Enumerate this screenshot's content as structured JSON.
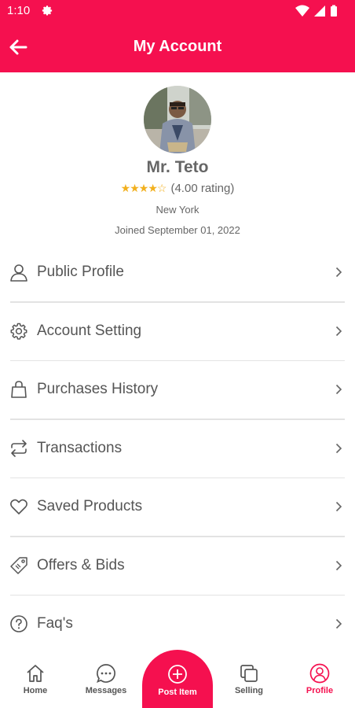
{
  "status_bar": {
    "time": "1:10"
  },
  "header": {
    "title": "My Account"
  },
  "profile": {
    "name": "Mr. Teto",
    "rating": 4,
    "rating_max": 5,
    "rating_text": "(4.00 rating)",
    "location": "New York",
    "joined": "Joined September 01, 2022"
  },
  "menu": [
    {
      "label": "Public Profile",
      "icon": "user-icon"
    },
    {
      "label": "Account Setting",
      "icon": "gear-icon"
    },
    {
      "label": "Purchases History",
      "icon": "shopping-bag-icon"
    },
    {
      "label": "Transactions",
      "icon": "swap-arrows-icon"
    },
    {
      "label": "Saved Products",
      "icon": "heart-icon"
    },
    {
      "label": "Offers & Bids",
      "icon": "tag-icon"
    },
    {
      "label": "Faq's",
      "icon": "help-circle-icon"
    }
  ],
  "bottom_nav": {
    "home": "Home",
    "messages": "Messages",
    "post": "Post Item",
    "selling": "Selling",
    "profile": "Profile",
    "active": "profile"
  },
  "colors": {
    "brand": "#f5104f",
    "star": "#f2b01e",
    "text": "#555555"
  }
}
